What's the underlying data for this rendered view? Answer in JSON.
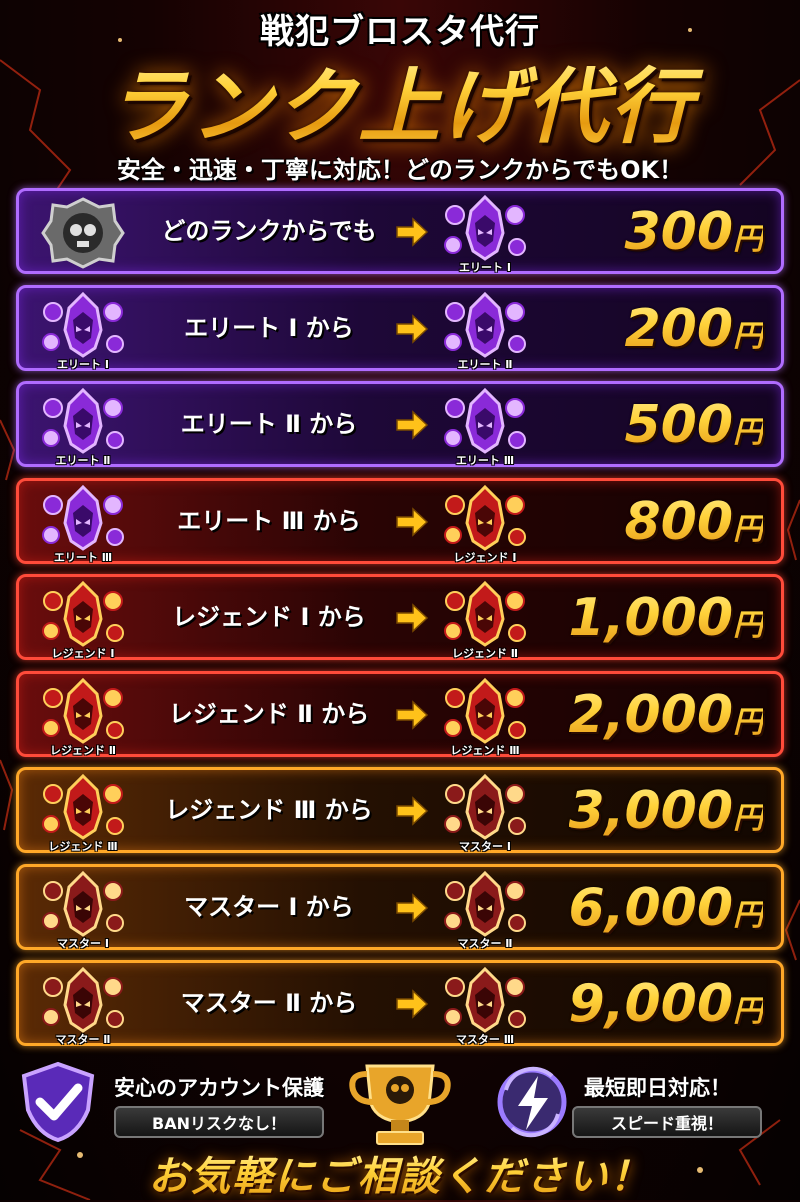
{
  "header": {
    "subtitle": "戦犯ブロスタ代行",
    "title": "ランク上げ代行",
    "tagline": "安全・迅速・丁寧に対応！どのランクからでもOK！"
  },
  "rows": [
    {
      "theme": "purple",
      "from_label": "",
      "from_icon": "skull-rank-icon",
      "text": "どのランクからでも",
      "to_label": "エリート Ⅰ",
      "to_icon": "elite-rank-icon",
      "price": "300",
      "unit": "円"
    },
    {
      "theme": "purple",
      "from_label": "エリート Ⅰ",
      "from_icon": "elite-rank-icon",
      "text": "エリート Ⅰ から",
      "to_label": "エリート Ⅱ",
      "to_icon": "elite-rank-icon",
      "price": "200",
      "unit": "円"
    },
    {
      "theme": "purple",
      "from_label": "エリート Ⅱ",
      "from_icon": "elite-rank-icon",
      "text": "エリート Ⅱ から",
      "to_label": "エリート Ⅲ",
      "to_icon": "elite-rank-icon",
      "price": "500",
      "unit": "円"
    },
    {
      "theme": "red",
      "from_label": "エリート Ⅲ",
      "from_icon": "elite-rank-icon",
      "text": "エリート Ⅲ から",
      "to_label": "レジェンド Ⅰ",
      "to_icon": "legend-rank-icon",
      "price": "800",
      "unit": "円"
    },
    {
      "theme": "red",
      "from_label": "レジェンド Ⅰ",
      "from_icon": "legend-rank-icon",
      "text": "レジェンド Ⅰ から",
      "to_label": "レジェンド Ⅱ",
      "to_icon": "legend-rank-icon",
      "price": "1,000",
      "unit": "円"
    },
    {
      "theme": "red",
      "from_label": "レジェンド Ⅱ",
      "from_icon": "legend-rank-icon",
      "text": "レジェンド Ⅱ から",
      "to_label": "レジェンド Ⅲ",
      "to_icon": "legend-rank-icon",
      "price": "2,000",
      "unit": "円"
    },
    {
      "theme": "orange",
      "from_label": "レジェンド Ⅲ",
      "from_icon": "legend-rank-icon",
      "text": "レジェンド Ⅲ から",
      "to_label": "マスター Ⅰ",
      "to_icon": "master-rank-icon",
      "price": "3,000",
      "unit": "円"
    },
    {
      "theme": "orange",
      "from_label": "マスター Ⅰ",
      "from_icon": "master-rank-icon",
      "text": "マスター Ⅰ から",
      "to_label": "マスター Ⅱ",
      "to_icon": "master-rank-icon",
      "price": "6,000",
      "unit": "円"
    },
    {
      "theme": "orange",
      "from_label": "マスター Ⅱ",
      "from_icon": "master-rank-icon",
      "text": "マスター Ⅱ から",
      "to_label": "マスター Ⅲ",
      "to_icon": "master-rank-icon",
      "price": "9,000",
      "unit": "円"
    }
  ],
  "footer": {
    "feature_left": {
      "icon": "shield-check-icon",
      "title": "安心のアカウント保護",
      "pill": "BANリスクなし！"
    },
    "center_icon": "trophy-skull-icon",
    "feature_right": {
      "icon": "lightning-refresh-icon",
      "title": "最短即日対応！",
      "pill": "スピード重視！"
    },
    "cta": "お気軽にご相談ください！"
  },
  "colors": {
    "purple": "#b06cff",
    "red": "#ff4b3a",
    "orange": "#ffa828",
    "gold": "#ffd23a",
    "bg": "#140202"
  }
}
